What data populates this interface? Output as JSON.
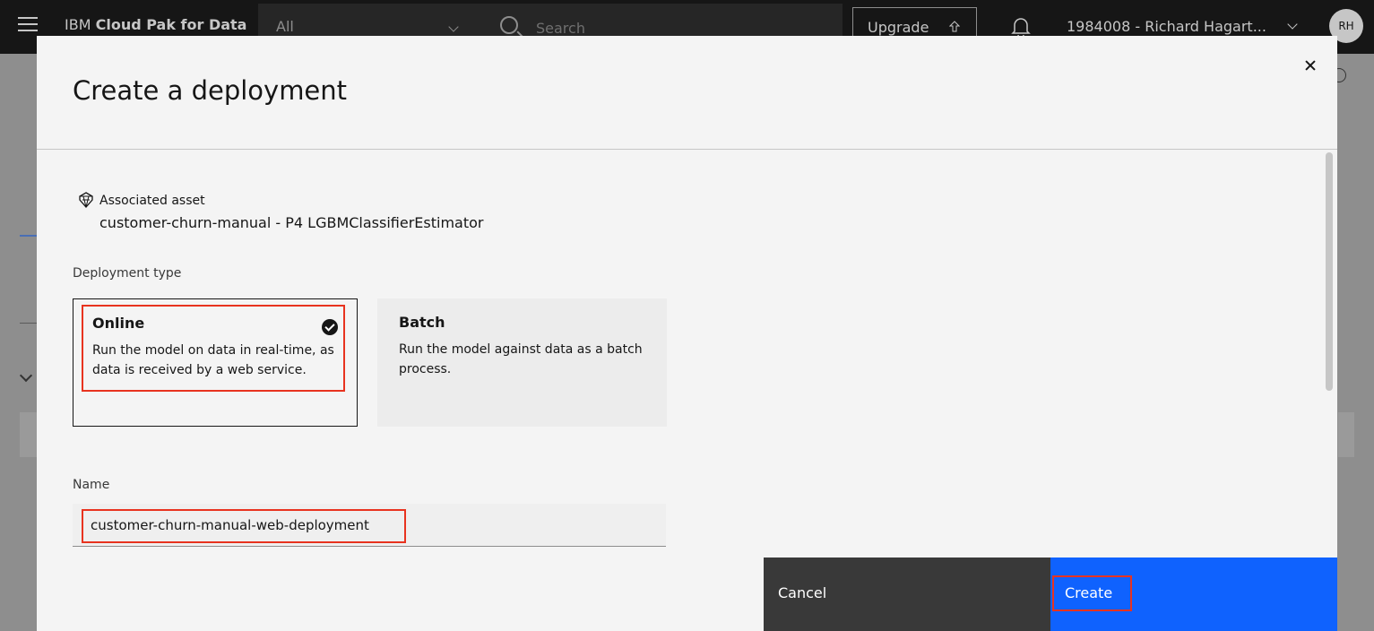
{
  "header": {
    "brand_prefix": "IBM",
    "brand_name": "Cloud Pak for Data",
    "scope_value": "All",
    "search_placeholder": "Search",
    "upgrade_label": "Upgrade",
    "account_label": "1984008 - Richard Hagart...",
    "avatar_initials": "RH"
  },
  "modal": {
    "title": "Create a deployment",
    "associated_asset_label": "Associated asset",
    "associated_asset_value": "customer-churn-manual - P4 LGBMClassifierEstimator",
    "deployment_type_label": "Deployment type",
    "tiles": [
      {
        "title": "Online",
        "description": "Run the model on data in real-time, as data is received by a web service.",
        "selected": true
      },
      {
        "title": "Batch",
        "description": "Run the model against data as a batch process.",
        "selected": false
      }
    ],
    "name_label": "Name",
    "name_value": "customer-churn-manual-web-deployment",
    "cancel_label": "Cancel",
    "create_label": "Create"
  },
  "colors": {
    "primary": "#0f62fe",
    "secondary_button": "#393939",
    "highlight": "#e8331f",
    "header_bg": "#161616"
  }
}
